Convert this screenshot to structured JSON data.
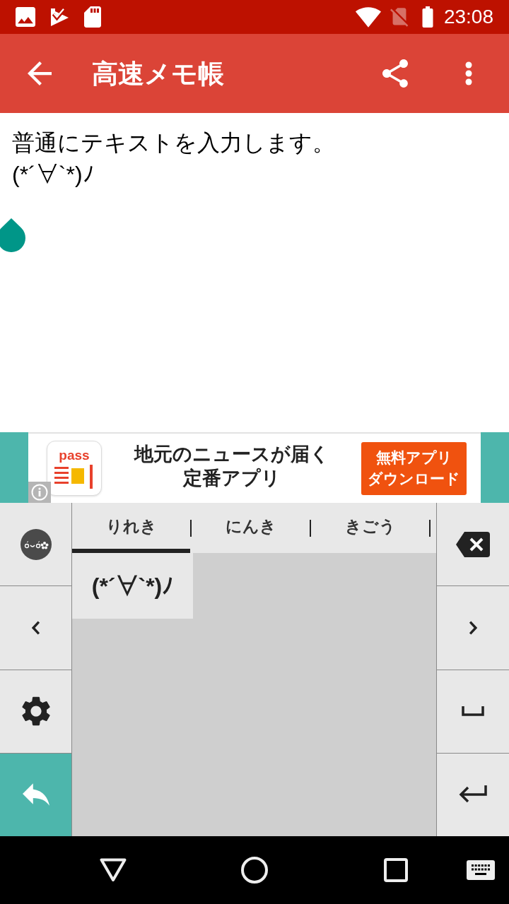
{
  "status_bar": {
    "time": "23:08"
  },
  "app_bar": {
    "title": "高速メモ帳"
  },
  "editor": {
    "lines": [
      "普通にテキストを入力します。",
      "(*´∀`*)ﾉ"
    ]
  },
  "ad": {
    "logo_text": "pass",
    "headline": [
      "地元のニュースが届く",
      "定番アプリ"
    ],
    "button": [
      "無料アプリ",
      "ダウンロード"
    ]
  },
  "keyboard": {
    "tabs": [
      {
        "label": "りれき",
        "selected": true
      },
      {
        "label": "にんき",
        "selected": false
      },
      {
        "label": "きごう",
        "selected": false
      }
    ],
    "candidates": [
      "(*´∀`*)ﾉ"
    ],
    "left_keys": [
      {
        "kind": "emoticon"
      },
      {
        "kind": "cursor_left"
      },
      {
        "kind": "settings"
      },
      {
        "kind": "undo"
      }
    ],
    "right_keys": [
      {
        "kind": "backspace"
      },
      {
        "kind": "cursor_right"
      },
      {
        "kind": "space"
      },
      {
        "kind": "enter"
      }
    ]
  }
}
